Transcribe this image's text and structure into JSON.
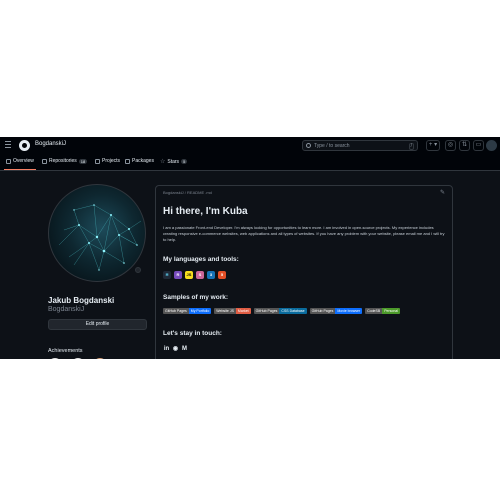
{
  "header": {
    "username": "BogdanskiJ",
    "search_placeholder": "Type / to search",
    "search_shortcut": "/",
    "plus_label": "+ ▾"
  },
  "tabs": [
    {
      "label": "Overview",
      "icon": "book-icon",
      "active": true
    },
    {
      "label": "Repositories",
      "icon": "repo-icon",
      "count": "18"
    },
    {
      "label": "Projects",
      "icon": "table-icon"
    },
    {
      "label": "Packages",
      "icon": "package-icon"
    },
    {
      "label": "Stars",
      "icon": "star-icon",
      "count": "5"
    }
  ],
  "profile": {
    "full_name": "Jakub Bogdanski",
    "login": "BogdanskiJ",
    "edit_label": "Edit profile",
    "achievements_title": "Achievements"
  },
  "readme": {
    "path": "BogdanskiJ / README .md",
    "heading": "Hi there, I'm Kuba",
    "intro": "I am a passionate Front-end Developer. I'm always looking for opportunities to learn more. I am involved in open-source projects. My experience includes creating responsive e-commerce websites, web applications and all types of websites. If you have any problem with your website, please email me and I will try to help.",
    "languages_title": "My languages and tools:",
    "languages": [
      {
        "name": "React",
        "color": "#1f2937",
        "glyph": "⚛"
      },
      {
        "name": "Redux",
        "color": "#764abc",
        "glyph": "R"
      },
      {
        "name": "JavaScript",
        "color": "#f7df1e",
        "glyph": "JS"
      },
      {
        "name": "Sass",
        "color": "#cc6699",
        "glyph": "S"
      },
      {
        "name": "CSS3",
        "color": "#1572b6",
        "glyph": "3"
      },
      {
        "name": "HTML5",
        "color": "#e34f26",
        "glyph": "5"
      }
    ],
    "samples_title": "Samples of my work:",
    "samples": [
      {
        "left": "GitHub Pages",
        "right": "My Portfolio",
        "color": "#0d6efd"
      },
      {
        "left": "Website JS",
        "right": "Market",
        "color": "#e05d44"
      },
      {
        "left": "GitHub Pages",
        "right": "CSS Database",
        "color": "#0a6c9e"
      },
      {
        "left": "GitHub Pages",
        "right": "Movie browser",
        "color": "#0d6efd"
      },
      {
        "left": "CodeSB",
        "right": "Personal",
        "color": "#4c9a2a"
      }
    ],
    "contact_title": "Let's stay in touch:",
    "socials": [
      {
        "name": "linkedin",
        "glyph": "in"
      },
      {
        "name": "github",
        "glyph": "◉"
      },
      {
        "name": "email",
        "glyph": "M"
      }
    ]
  },
  "colors": {
    "background": "#0d1117",
    "header": "#010409",
    "border": "#30363d",
    "accent": "#f78166"
  }
}
